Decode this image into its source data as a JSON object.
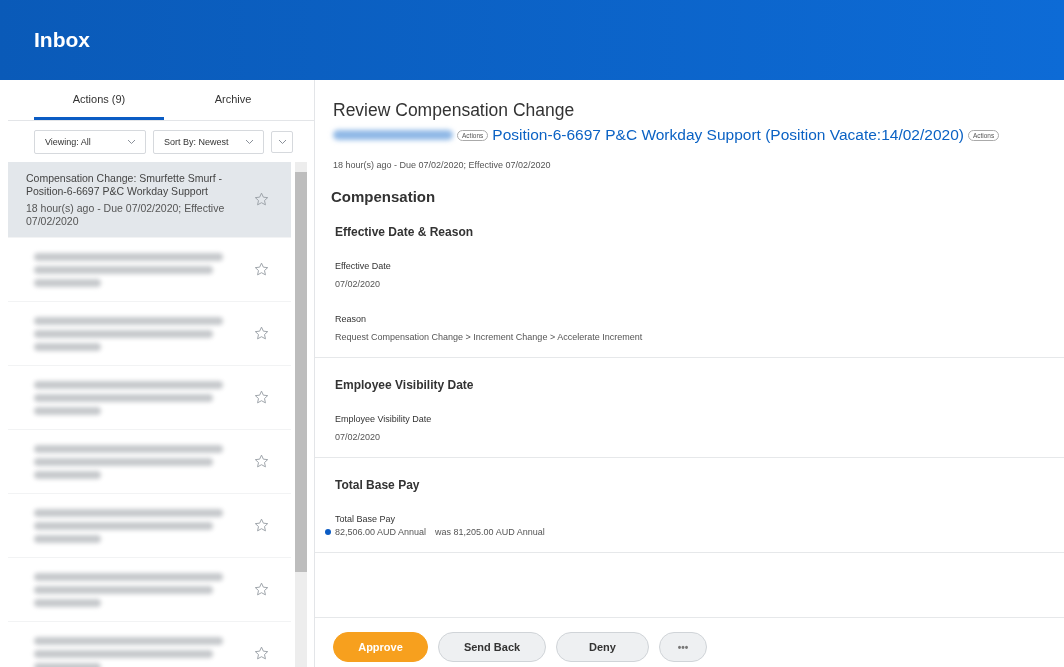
{
  "header": {
    "title": "Inbox"
  },
  "tabs": [
    {
      "label": "Actions (9)",
      "selected": true
    },
    {
      "label": "Archive",
      "selected": false
    }
  ],
  "filters": [
    {
      "label": "Viewing: All"
    },
    {
      "label": "Sort By: Newest"
    }
  ],
  "inbox_items": [
    {
      "kind": "text",
      "title": "Compensation Change: Smurfette Smurf - Position-6-6697 P&C Workday Support",
      "meta": "18 hour(s) ago - Due 07/02/2020; Effective 07/02/2020",
      "selected": true
    },
    {
      "kind": "redacted",
      "selected": false
    },
    {
      "kind": "redacted",
      "selected": false
    },
    {
      "kind": "redacted",
      "selected": false
    },
    {
      "kind": "redacted",
      "selected": false
    },
    {
      "kind": "redacted",
      "selected": false
    },
    {
      "kind": "redacted",
      "selected": false
    },
    {
      "kind": "redacted",
      "selected": false
    }
  ],
  "detail": {
    "title": "Review Compensation Change",
    "subtitle_parts": [
      {
        "kind": "redacted"
      },
      {
        "kind": "chip",
        "text": "Actions"
      },
      {
        "kind": "link",
        "text": "Position-6-6697 P&C Workday Support (Position Vacate:14/02/2020)"
      },
      {
        "kind": "chip",
        "text": "Actions"
      }
    ],
    "meta": "18 hour(s) ago - Due 07/02/2020; Effective 07/02/2020",
    "heading": "Compensation",
    "sections": [
      {
        "title": "Effective Date & Reason",
        "fields": [
          {
            "kind": "plain",
            "label": "Effective Date",
            "value": "07/02/2020"
          },
          {
            "kind": "plain",
            "label": "Reason",
            "value": "Request Compensation Change > Increment Change > Accelerate Increment"
          }
        ]
      },
      {
        "title": "Employee Visibility Date",
        "fields": [
          {
            "kind": "plain",
            "label": "Employee Visibility Date",
            "value": "07/02/2020"
          }
        ]
      },
      {
        "title": "Total Base Pay",
        "fields": [
          {
            "kind": "change",
            "label": "Total Base Pay",
            "value": "82,506.00 AUD Annual",
            "previous": "was 81,205.00 AUD Annual"
          }
        ]
      }
    ]
  },
  "buttons": [
    {
      "kind": "primary",
      "label": "Approve"
    },
    {
      "kind": "secondary",
      "label": "Send Back"
    },
    {
      "kind": "secondary",
      "label": "Deny"
    },
    {
      "kind": "more",
      "label": "•••"
    }
  ]
}
